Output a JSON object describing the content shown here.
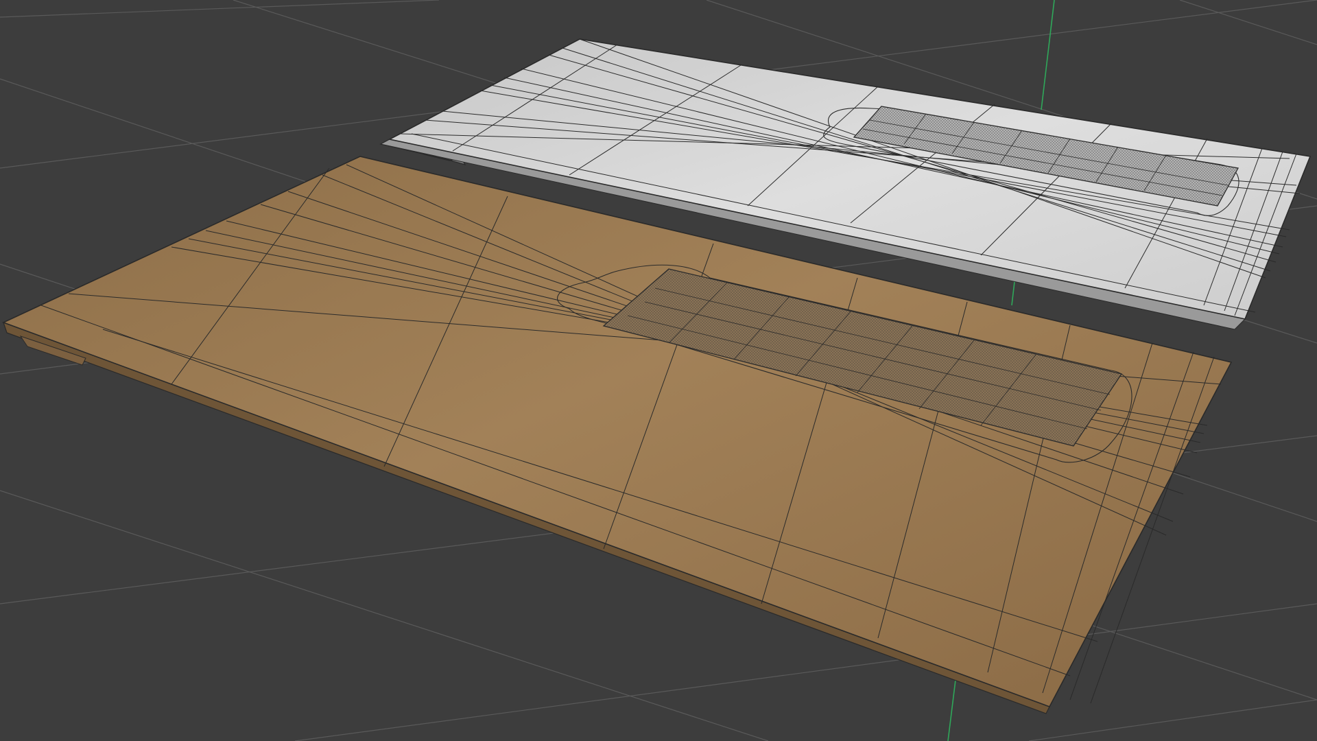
{
  "viewport": {
    "background_color": "#3d3d3d",
    "grid_color": "#5a5a5a",
    "y_axis_color": "#2fa85a",
    "grid_visible": true
  },
  "objects": [
    {
      "name": "panel-gray",
      "material": "clay-gray",
      "color": "#d4d4d4",
      "wireframe_color": "#2a2a2a",
      "feature": "recessed-slot"
    },
    {
      "name": "panel-tan",
      "material": "cardboard-tan",
      "color": "#a88558",
      "wireframe_color": "#2a2a2a",
      "feature": "recessed-slot"
    }
  ]
}
